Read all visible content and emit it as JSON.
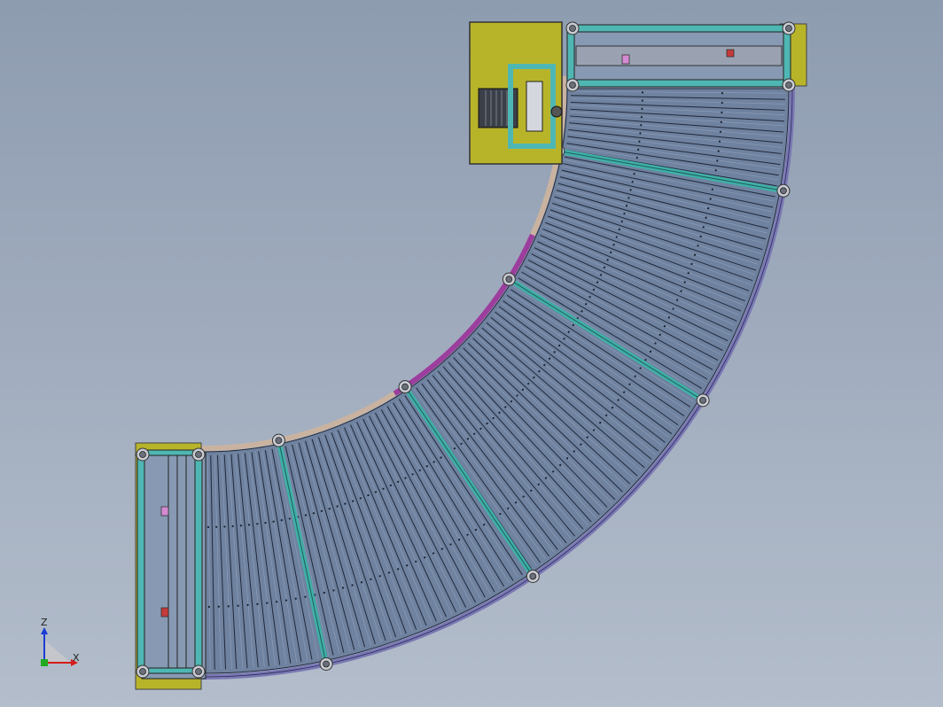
{
  "window": {
    "title": ""
  },
  "model": {
    "name": "",
    "sections": [
      {
        "id": "infeed-straight"
      },
      {
        "id": "curve-90"
      },
      {
        "id": "drive-unit"
      },
      {
        "id": "outfeed-straight"
      }
    ]
  },
  "colors": {
    "background_top": "#8e9cb0",
    "background_bottom": "#b3bdcb",
    "roller_fill": "#6f829f",
    "roller_line": "#20283a",
    "rail_outer": "#7a78b4",
    "rail_inner_tan": "#c9b3a0",
    "rail_inner_magenta": "#9c3e9e",
    "tie_bar": "#3fb0a8",
    "frame_cyan": "#4fb7b3",
    "motor_plate": "#b8b42a",
    "bolt": "#c8cbd2",
    "shaft": "#9aa2b2",
    "axis_x": "#d41b1b",
    "axis_y": "#22aa22",
    "axis_z": "#1b3bd4"
  },
  "triad": {
    "x_label": "X",
    "z_label": "Z"
  }
}
